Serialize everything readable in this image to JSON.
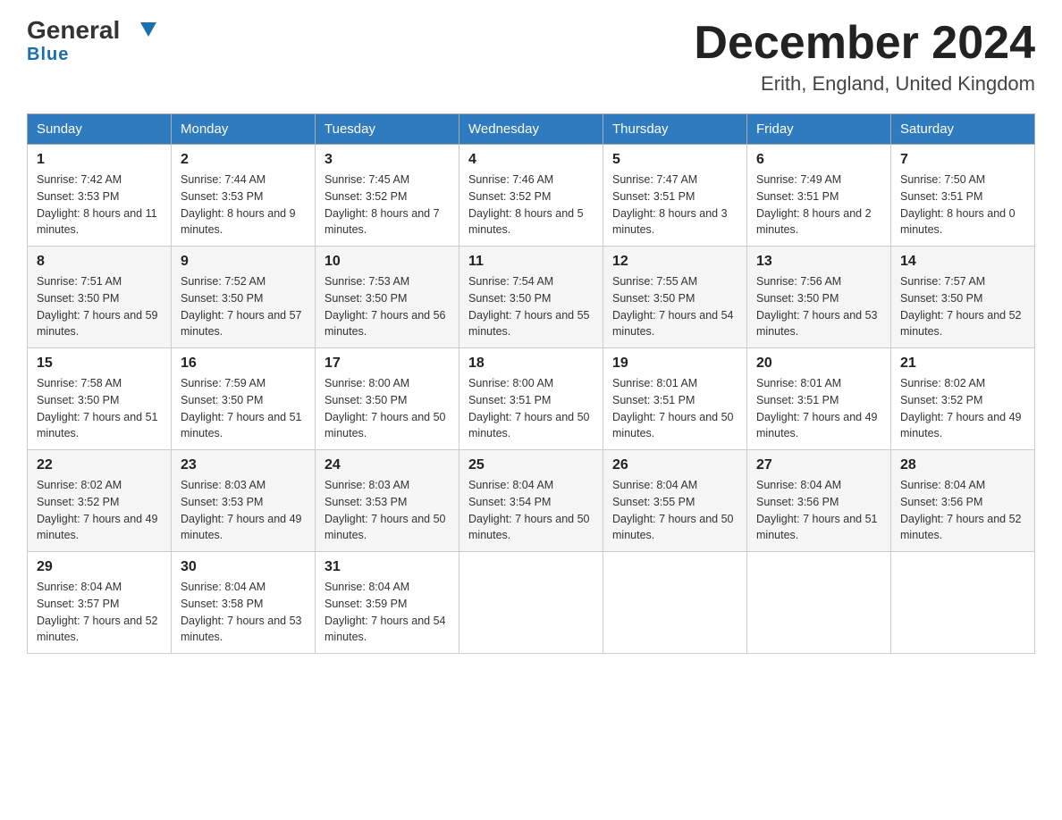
{
  "header": {
    "logo": {
      "general": "General",
      "blue_arrow": "▼",
      "blue_text": "Blue"
    },
    "title": "December 2024",
    "subtitle": "Erith, England, United Kingdom"
  },
  "calendar": {
    "weekdays": [
      "Sunday",
      "Monday",
      "Tuesday",
      "Wednesday",
      "Thursday",
      "Friday",
      "Saturday"
    ],
    "weeks": [
      [
        {
          "day": "1",
          "sunrise": "7:42 AM",
          "sunset": "3:53 PM",
          "daylight": "8 hours and 11 minutes."
        },
        {
          "day": "2",
          "sunrise": "7:44 AM",
          "sunset": "3:53 PM",
          "daylight": "8 hours and 9 minutes."
        },
        {
          "day": "3",
          "sunrise": "7:45 AM",
          "sunset": "3:52 PM",
          "daylight": "8 hours and 7 minutes."
        },
        {
          "day": "4",
          "sunrise": "7:46 AM",
          "sunset": "3:52 PM",
          "daylight": "8 hours and 5 minutes."
        },
        {
          "day": "5",
          "sunrise": "7:47 AM",
          "sunset": "3:51 PM",
          "daylight": "8 hours and 3 minutes."
        },
        {
          "day": "6",
          "sunrise": "7:49 AM",
          "sunset": "3:51 PM",
          "daylight": "8 hours and 2 minutes."
        },
        {
          "day": "7",
          "sunrise": "7:50 AM",
          "sunset": "3:51 PM",
          "daylight": "8 hours and 0 minutes."
        }
      ],
      [
        {
          "day": "8",
          "sunrise": "7:51 AM",
          "sunset": "3:50 PM",
          "daylight": "7 hours and 59 minutes."
        },
        {
          "day": "9",
          "sunrise": "7:52 AM",
          "sunset": "3:50 PM",
          "daylight": "7 hours and 57 minutes."
        },
        {
          "day": "10",
          "sunrise": "7:53 AM",
          "sunset": "3:50 PM",
          "daylight": "7 hours and 56 minutes."
        },
        {
          "day": "11",
          "sunrise": "7:54 AM",
          "sunset": "3:50 PM",
          "daylight": "7 hours and 55 minutes."
        },
        {
          "day": "12",
          "sunrise": "7:55 AM",
          "sunset": "3:50 PM",
          "daylight": "7 hours and 54 minutes."
        },
        {
          "day": "13",
          "sunrise": "7:56 AM",
          "sunset": "3:50 PM",
          "daylight": "7 hours and 53 minutes."
        },
        {
          "day": "14",
          "sunrise": "7:57 AM",
          "sunset": "3:50 PM",
          "daylight": "7 hours and 52 minutes."
        }
      ],
      [
        {
          "day": "15",
          "sunrise": "7:58 AM",
          "sunset": "3:50 PM",
          "daylight": "7 hours and 51 minutes."
        },
        {
          "day": "16",
          "sunrise": "7:59 AM",
          "sunset": "3:50 PM",
          "daylight": "7 hours and 51 minutes."
        },
        {
          "day": "17",
          "sunrise": "8:00 AM",
          "sunset": "3:50 PM",
          "daylight": "7 hours and 50 minutes."
        },
        {
          "day": "18",
          "sunrise": "8:00 AM",
          "sunset": "3:51 PM",
          "daylight": "7 hours and 50 minutes."
        },
        {
          "day": "19",
          "sunrise": "8:01 AM",
          "sunset": "3:51 PM",
          "daylight": "7 hours and 50 minutes."
        },
        {
          "day": "20",
          "sunrise": "8:01 AM",
          "sunset": "3:51 PM",
          "daylight": "7 hours and 49 minutes."
        },
        {
          "day": "21",
          "sunrise": "8:02 AM",
          "sunset": "3:52 PM",
          "daylight": "7 hours and 49 minutes."
        }
      ],
      [
        {
          "day": "22",
          "sunrise": "8:02 AM",
          "sunset": "3:52 PM",
          "daylight": "7 hours and 49 minutes."
        },
        {
          "day": "23",
          "sunrise": "8:03 AM",
          "sunset": "3:53 PM",
          "daylight": "7 hours and 49 minutes."
        },
        {
          "day": "24",
          "sunrise": "8:03 AM",
          "sunset": "3:53 PM",
          "daylight": "7 hours and 50 minutes."
        },
        {
          "day": "25",
          "sunrise": "8:04 AM",
          "sunset": "3:54 PM",
          "daylight": "7 hours and 50 minutes."
        },
        {
          "day": "26",
          "sunrise": "8:04 AM",
          "sunset": "3:55 PM",
          "daylight": "7 hours and 50 minutes."
        },
        {
          "day": "27",
          "sunrise": "8:04 AM",
          "sunset": "3:56 PM",
          "daylight": "7 hours and 51 minutes."
        },
        {
          "day": "28",
          "sunrise": "8:04 AM",
          "sunset": "3:56 PM",
          "daylight": "7 hours and 52 minutes."
        }
      ],
      [
        {
          "day": "29",
          "sunrise": "8:04 AM",
          "sunset": "3:57 PM",
          "daylight": "7 hours and 52 minutes."
        },
        {
          "day": "30",
          "sunrise": "8:04 AM",
          "sunset": "3:58 PM",
          "daylight": "7 hours and 53 minutes."
        },
        {
          "day": "31",
          "sunrise": "8:04 AM",
          "sunset": "3:59 PM",
          "daylight": "7 hours and 54 minutes."
        },
        null,
        null,
        null,
        null
      ]
    ]
  }
}
